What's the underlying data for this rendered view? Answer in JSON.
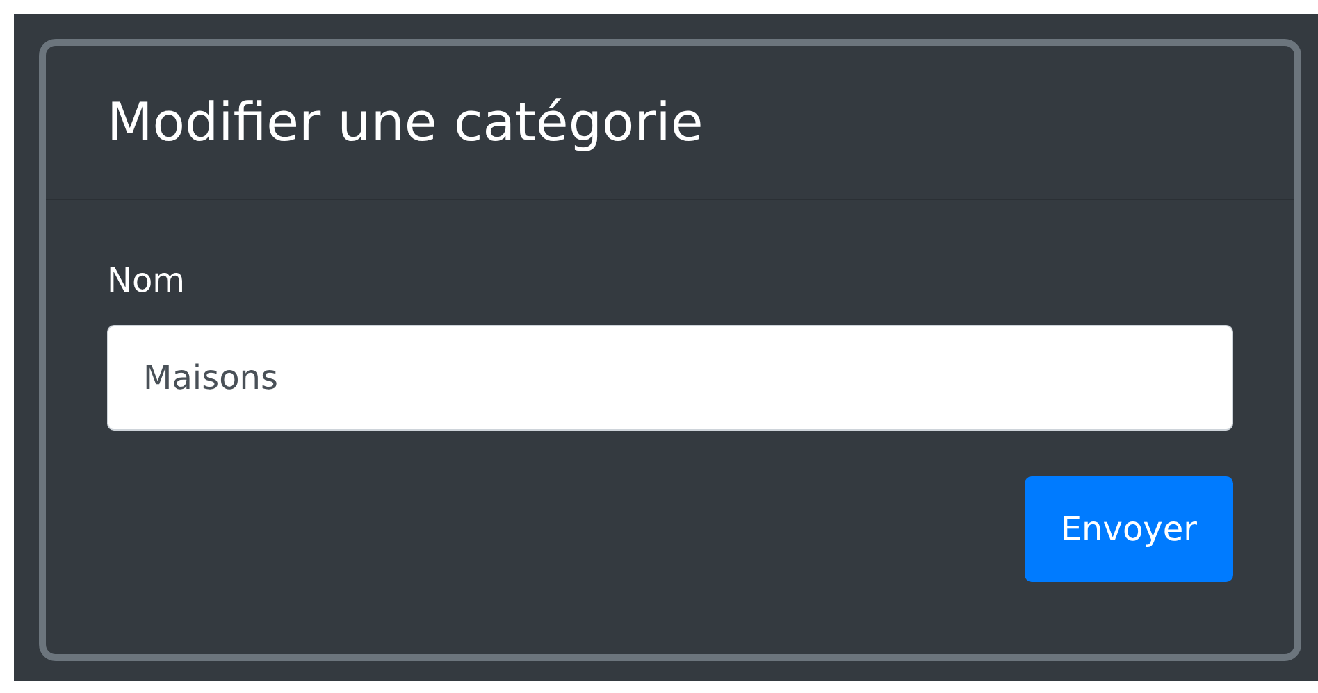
{
  "card": {
    "title": "Modifier une catégorie"
  },
  "form": {
    "label": "Nom",
    "value": "Maisons"
  },
  "buttons": [
    {
      "label": "Envoyer"
    }
  ]
}
